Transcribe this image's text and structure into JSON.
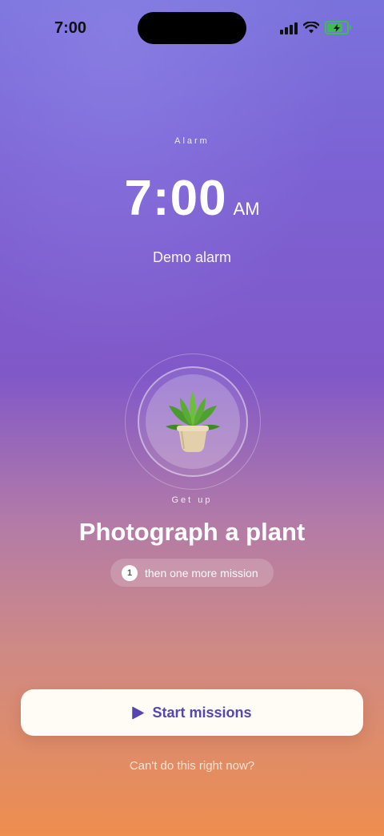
{
  "status_bar": {
    "time": "7:00",
    "icons": [
      "cellular-signal-icon",
      "wifi-icon",
      "battery-charging-icon"
    ],
    "battery_level": 0.72
  },
  "alarm": {
    "label": "Alarm",
    "time": "7:00",
    "ampm": "AM",
    "name": "Demo alarm"
  },
  "mission": {
    "icon": "potted-plant-icon",
    "eyebrow": "Get up",
    "title": "Photograph a plant",
    "remaining_count": "1",
    "remaining_text": "then one more mission"
  },
  "actions": {
    "start_label": "Start missions",
    "start_icon": "play-icon",
    "skip_label": "Can't do this right now?"
  },
  "colors": {
    "accent": "#5645b3",
    "background_top": "#7a72dc",
    "background_bottom": "#ee8e4f",
    "button_bg": "#fffcf6"
  }
}
